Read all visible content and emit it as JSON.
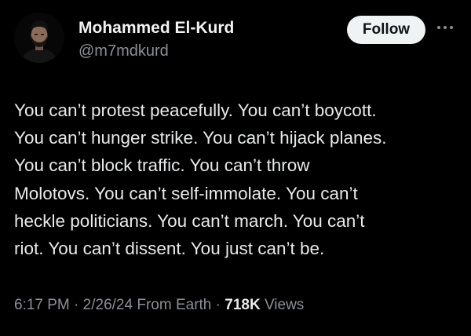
{
  "author": {
    "display_name": "Mohammed El-Kurd",
    "handle": "@m7mdkurd"
  },
  "actions": {
    "follow_label": "Follow",
    "more_icon": "more-horizontal-icon"
  },
  "tweet": {
    "lines": [
      "You can’t protest peacefully. You can’t boycott.",
      "You can’t hunger strike. You can’t hijack planes.",
      "You can’t block traffic. You can’t throw",
      "Molotovs. You can’t self-immolate. You can’t",
      "heckle politicians. You can’t march. You can’t",
      "riot. You can’t dissent. You just can’t be."
    ]
  },
  "meta": {
    "time": "6:17 PM",
    "separator": "·",
    "date": "2/26/24",
    "source": "From Earth",
    "views_count": "718K",
    "views_label": "Views"
  },
  "colors": {
    "background": "#000000",
    "primary_text": "#e7e9ea",
    "secondary_text": "#8b9096",
    "follow_bg": "#eff3f4",
    "follow_text": "#0f1419"
  }
}
